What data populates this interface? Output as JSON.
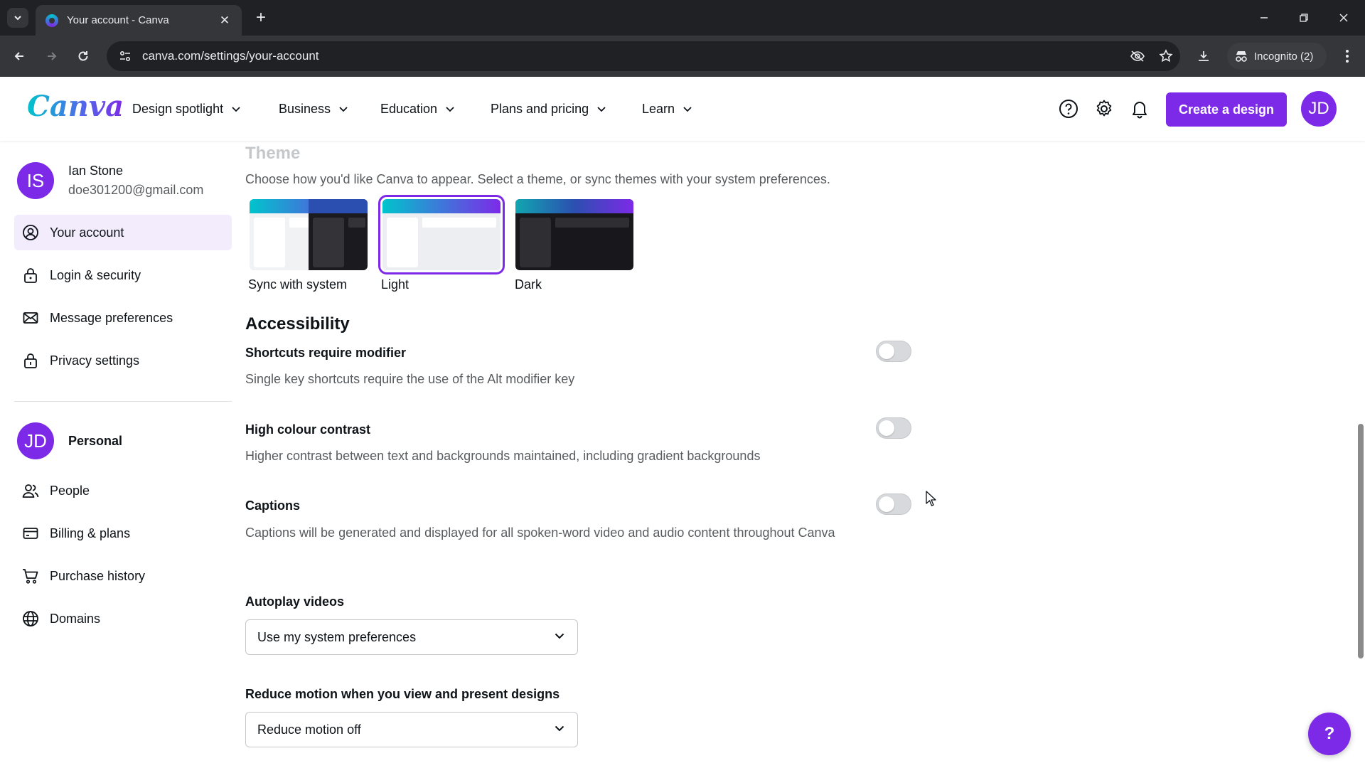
{
  "browser": {
    "tab_title": "Your account - Canva",
    "url": "canva.com/settings/your-account",
    "incognito_label": "Incognito (2)"
  },
  "header": {
    "logo": "Canva",
    "nav": [
      {
        "label": "Design spotlight"
      },
      {
        "label": "Business"
      },
      {
        "label": "Education"
      },
      {
        "label": "Plans and pricing"
      },
      {
        "label": "Learn"
      }
    ],
    "create_button": "Create a design",
    "avatar_initials": "JD"
  },
  "sidebar": {
    "user": {
      "initials": "IS",
      "name": "Ian Stone",
      "email": "doe301200@gmail.com"
    },
    "account_items": [
      {
        "label": "Your account",
        "icon": "user-circle-icon",
        "active": true
      },
      {
        "label": "Login & security",
        "icon": "lock-icon"
      },
      {
        "label": "Message preferences",
        "icon": "mail-icon"
      },
      {
        "label": "Privacy settings",
        "icon": "privacy-lock-icon"
      }
    ],
    "team": {
      "initials": "JD",
      "name": "Personal"
    },
    "team_items": [
      {
        "label": "People",
        "icon": "people-icon"
      },
      {
        "label": "Billing & plans",
        "icon": "credit-card-icon"
      },
      {
        "label": "Purchase history",
        "icon": "cart-icon"
      },
      {
        "label": "Domains",
        "icon": "globe-icon"
      }
    ]
  },
  "main": {
    "theme": {
      "heading": "Theme",
      "description": "Choose how you'd like Canva to appear. Select a theme, or sync themes with your system preferences.",
      "options": [
        {
          "label": "Sync with system",
          "selected": false
        },
        {
          "label": "Light",
          "selected": true
        },
        {
          "label": "Dark",
          "selected": false
        }
      ]
    },
    "accessibility": {
      "heading": "Accessibility",
      "settings": [
        {
          "title": "Shortcuts require modifier",
          "description": "Single key shortcuts require the use of the Alt modifier key",
          "enabled": false
        },
        {
          "title": "High colour contrast",
          "description": "Higher contrast between text and backgrounds maintained, including gradient backgrounds",
          "enabled": false
        },
        {
          "title": "Captions",
          "description": "Captions will be generated and displayed for all spoken-word video and audio content throughout Canva",
          "enabled": false
        }
      ],
      "autoplay": {
        "title": "Autoplay videos",
        "value": "Use my system preferences"
      },
      "reduce_motion": {
        "title": "Reduce motion when you view and present designs",
        "value": "Reduce motion off"
      }
    }
  },
  "help_fab": "?",
  "colors": {
    "accent": "#7d2ae8",
    "accent_light": "#f2ecfd",
    "teal": "#00c4cc"
  }
}
